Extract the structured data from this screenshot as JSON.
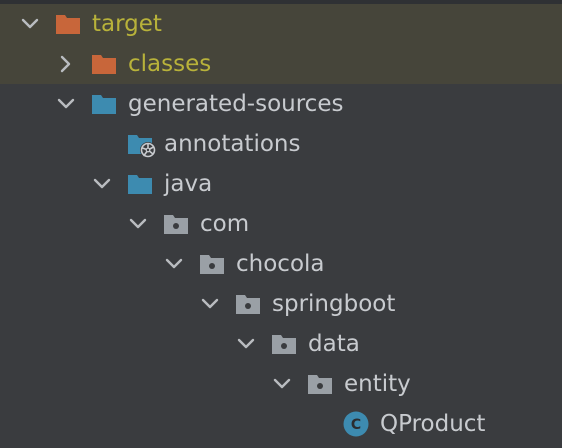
{
  "tree": {
    "nodes": [
      {
        "label": "target",
        "icon": "folder-excluded-icon",
        "expanded": true,
        "excluded": true
      },
      {
        "label": "classes",
        "icon": "folder-excluded-icon",
        "expanded": false,
        "excluded": true
      },
      {
        "label": "generated-sources",
        "icon": "folder-source-icon",
        "expanded": true
      },
      {
        "label": "annotations",
        "icon": "folder-generated-icon"
      },
      {
        "label": "java",
        "icon": "folder-source-icon",
        "expanded": true
      },
      {
        "label": "com",
        "icon": "package-icon",
        "expanded": true
      },
      {
        "label": "chocola",
        "icon": "package-icon",
        "expanded": true
      },
      {
        "label": "springboot",
        "icon": "package-icon",
        "expanded": true
      },
      {
        "label": "data",
        "icon": "package-icon",
        "expanded": true
      },
      {
        "label": "entity",
        "icon": "package-icon",
        "expanded": true
      },
      {
        "label": "QProduct",
        "icon": "class-icon"
      }
    ]
  },
  "colors": {
    "background": "#3a3c3f",
    "excluded_row": "#46453a",
    "excluded_text": "#b8b23a",
    "text": "#c8cbcf",
    "excluded_folder": "#c8663a",
    "source_folder": "#3d8bb0",
    "package": "#9aa0a6",
    "class_badge": "#3d8bb0"
  }
}
